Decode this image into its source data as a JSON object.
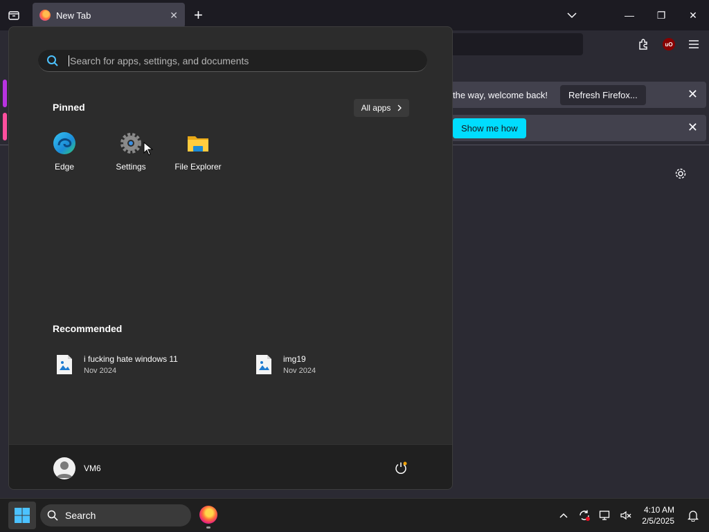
{
  "browser": {
    "tab_title": "New Tab",
    "tab_close": "✕",
    "new_tab": "+",
    "window_controls": {
      "minimize": "—",
      "restore": "❐",
      "close": "✕"
    }
  },
  "notifications": {
    "welcome_msg": "the way, welcome back!",
    "refresh_label": "Refresh Firefox...",
    "show_me_how": "Show me how",
    "close": "✕"
  },
  "start_menu": {
    "search_placeholder": "Search for apps, settings, and documents",
    "pinned_title": "Pinned",
    "all_apps": "All apps",
    "pinned": [
      {
        "label": "Edge",
        "icon": "edge-icon"
      },
      {
        "label": "Settings",
        "icon": "gear-icon"
      },
      {
        "label": "File Explorer",
        "icon": "folder-icon"
      }
    ],
    "recommended_title": "Recommended",
    "recommended": [
      {
        "name": "i fucking hate windows 11",
        "date": "Nov 2024"
      },
      {
        "name": "img19",
        "date": "Nov 2024"
      }
    ],
    "user_name": "VM6"
  },
  "taskbar": {
    "search_label": "Search",
    "time": "4:10 AM",
    "date": "2/5/2025"
  },
  "colors": {
    "accent": "#00ddff",
    "windows_blue": "#0078d4"
  }
}
